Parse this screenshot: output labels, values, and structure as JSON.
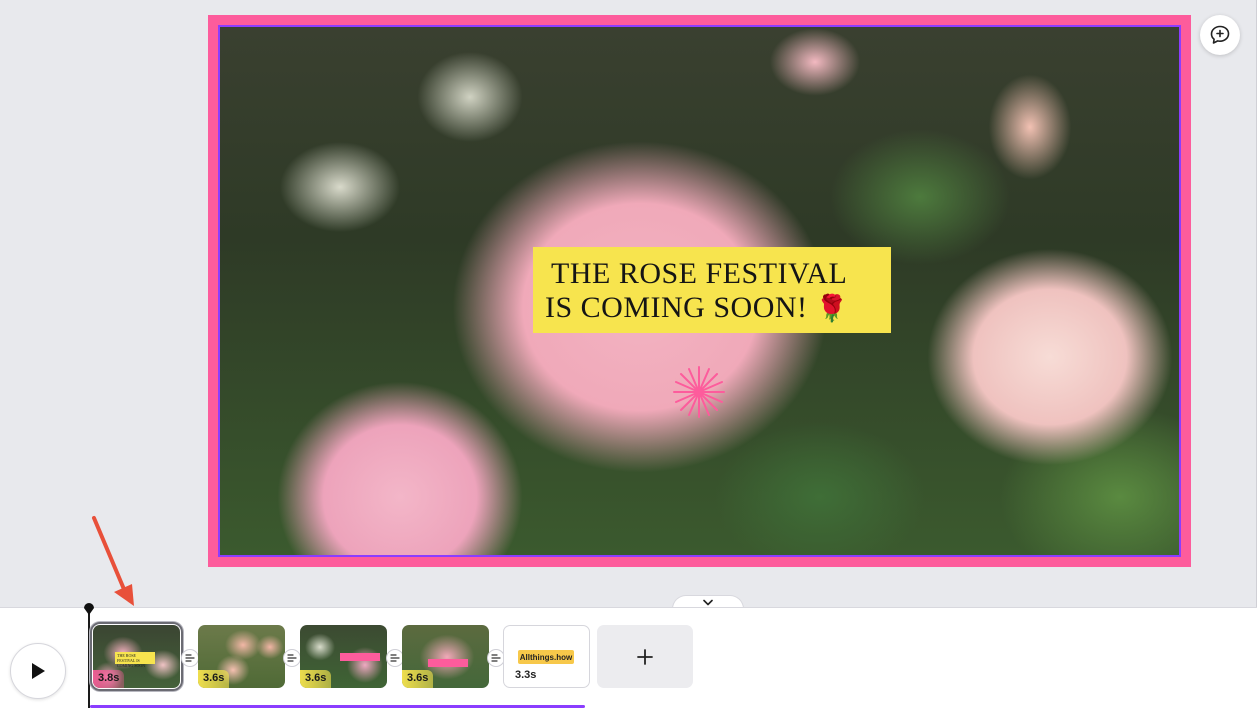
{
  "canvas": {
    "caption_line1": "THE ROSE FESTIVAL",
    "caption_line2": "IS COMING SOON!",
    "caption_emoji": "🌹",
    "frame_color": "#fd5c9c",
    "selection_color": "#8b3dff",
    "caption_bg": "#f7e44e"
  },
  "toolbar": {
    "comment_icon": "comment-plus-icon",
    "collapse_icon": "chevron-down-icon"
  },
  "timeline": {
    "play_icon": "play-icon",
    "add_icon": "plus-icon",
    "progress_color": "#8b3dff",
    "clips": [
      {
        "duration": "3.8s",
        "selected": true,
        "thumb_caption": "THE ROSE FESTIVAL IS COMING SOON"
      },
      {
        "duration": "3.6s",
        "selected": false
      },
      {
        "duration": "3.6s",
        "selected": false
      },
      {
        "duration": "3.6s",
        "selected": false
      },
      {
        "duration": "3.3s",
        "selected": false,
        "brand_text": "Allthings.how"
      }
    ]
  },
  "annotation": {
    "arrow_color": "#e8503a"
  }
}
